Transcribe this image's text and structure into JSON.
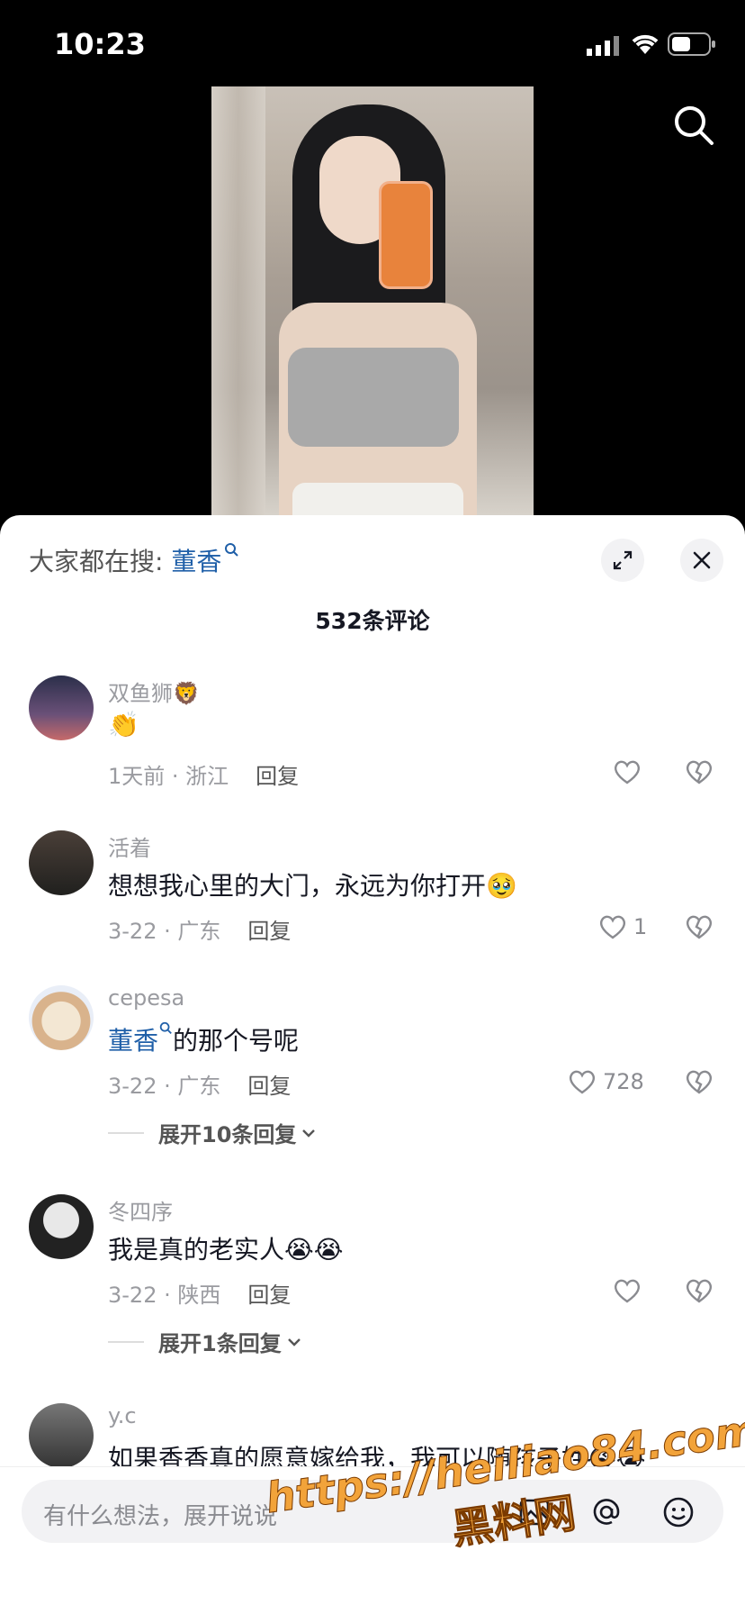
{
  "status_bar": {
    "time": "10:23"
  },
  "sheet": {
    "search_prefix": "大家都在搜: ",
    "search_keyword": "董香",
    "comment_count": "532条评论"
  },
  "comments": [
    {
      "name": "双鱼狮🦁",
      "text": "👏",
      "meta": "1天前 · 浙江",
      "reply": "回复",
      "likes": ""
    },
    {
      "name": "活着",
      "text": "想想我心里的大门，永远为你打开🥹",
      "meta": "3-22 · 广东",
      "reply": "回复",
      "likes": "1"
    },
    {
      "name": "cepesa",
      "text_keyword": "董香",
      "text_rest": "的那个号呢",
      "meta": "3-22 · 广东",
      "reply": "回复",
      "likes": "728",
      "expand": "展开10条回复"
    },
    {
      "name": "冬四序",
      "text": "我是真的老实人😭😭",
      "meta": "3-22 · 陕西",
      "reply": "回复",
      "likes": "",
      "expand": "展开1条回复"
    },
    {
      "name": "y.c",
      "text": "如果香香真的愿意嫁给我，我可以随孩子姓😭😭"
    }
  ],
  "input": {
    "placeholder": "有什么想法，展开说说"
  },
  "watermark": {
    "url": "https://heiliao84.com",
    "cn": "黑料网"
  },
  "colors": {
    "keyword": "#1f5fa8",
    "muted": "#9a9ba0",
    "accent_watermark": "#f2a33a"
  },
  "icons": [
    "search-icon",
    "expand-icon",
    "close-icon",
    "heart-icon",
    "dislike-icon",
    "chevron-down-icon",
    "image-icon",
    "at-icon",
    "emoji-icon"
  ]
}
